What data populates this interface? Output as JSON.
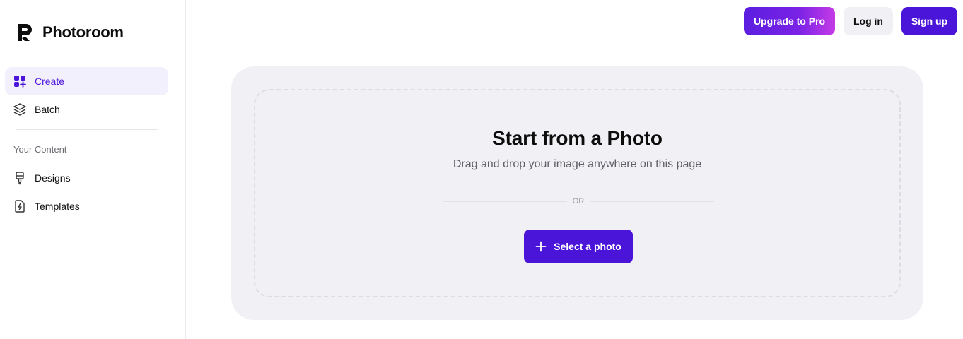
{
  "brand": {
    "name": "Photoroom"
  },
  "sidebar": {
    "items": [
      {
        "label": "Create",
        "icon": "grid-plus-icon",
        "active": true
      },
      {
        "label": "Batch",
        "icon": "layers-icon",
        "active": false
      }
    ],
    "section_label": "Your Content",
    "content_items": [
      {
        "label": "Designs",
        "icon": "brush-icon"
      },
      {
        "label": "Templates",
        "icon": "template-bolt-icon"
      }
    ]
  },
  "header": {
    "upgrade_label": "Upgrade to Pro",
    "login_label": "Log in",
    "signup_label": "Sign up"
  },
  "main": {
    "title": "Start from a Photo",
    "subtitle": "Drag and drop your image anywhere on this page",
    "or_label": "OR",
    "select_label": "Select a photo"
  },
  "colors": {
    "accent": "#4a14d9",
    "active_bg": "#f2f0fd",
    "card_bg": "#f1f1f5"
  }
}
